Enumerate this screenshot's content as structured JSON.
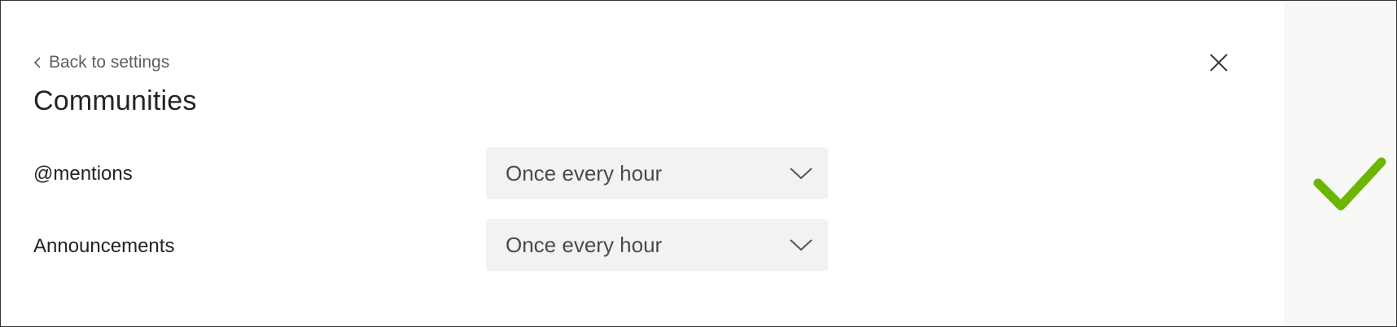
{
  "header": {
    "back_label": "Back to settings",
    "title": "Communities"
  },
  "settings": [
    {
      "label": "@mentions",
      "value": "Once every hour"
    },
    {
      "label": "Announcements",
      "value": "Once every hour"
    }
  ],
  "icons": {
    "back": "chevron-left-icon",
    "close": "close-icon",
    "dropdown": "chevron-down-icon",
    "status": "checkmark-icon"
  },
  "colors": {
    "checkmark": "#6bb700",
    "dropdown_bg": "#f3f2f1",
    "side_bg": "#f8f8f6"
  }
}
